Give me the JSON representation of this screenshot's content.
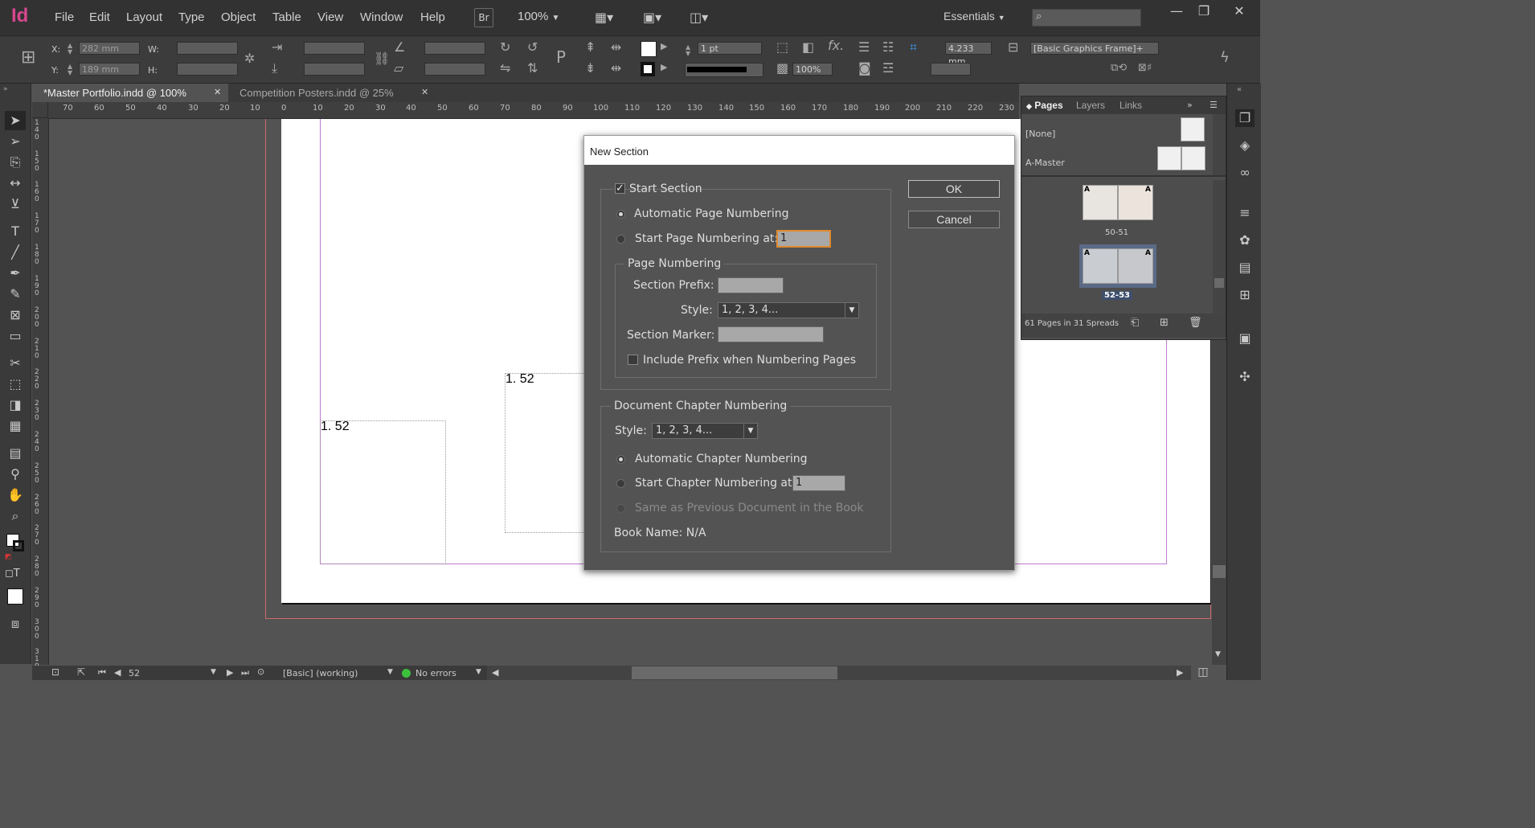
{
  "app": {
    "logo": "Id"
  },
  "menu": [
    "File",
    "Edit",
    "Layout",
    "Type",
    "Object",
    "Table",
    "View",
    "Window",
    "Help"
  ],
  "menubar": {
    "bridge": "Br",
    "zoom": "100%",
    "workspace": "Essentials"
  },
  "window_controls": {
    "minimize": "—",
    "maximize": "❐",
    "close": "✕"
  },
  "control": {
    "x_label": "X:",
    "x_value": "282 mm",
    "y_label": "Y:",
    "y_value": "189 mm",
    "w_label": "W:",
    "h_label": "H:",
    "stroke_weight": "1 pt",
    "opacity": "100%",
    "fitting_value": "4.233 mm",
    "object_style": "[Basic Graphics Frame]+"
  },
  "tabs": [
    {
      "label": "*Master Portfolio.indd @ 100%",
      "close": "✕"
    },
    {
      "label": "Competition Posters.indd @ 25%",
      "close": "✕"
    }
  ],
  "ruler_h": [
    "70",
    "60",
    "50",
    "40",
    "30",
    "20",
    "10",
    "0",
    "10",
    "20",
    "30",
    "40",
    "50",
    "60",
    "70",
    "80",
    "90",
    "100",
    "110",
    "120",
    "130",
    "140",
    "150",
    "160",
    "170",
    "180",
    "190",
    "200",
    "210",
    "220",
    "230"
  ],
  "ruler_v": [
    "140",
    "150",
    "160",
    "170",
    "180",
    "190",
    "200",
    "210",
    "220",
    "230",
    "240",
    "250",
    "260",
    "270",
    "280",
    "290",
    "300",
    "310"
  ],
  "page_content": {
    "frame1_text": "1.  52",
    "frame2_text": "1.  52"
  },
  "pages_panel": {
    "tabs": [
      "Pages",
      "Layers",
      "Links"
    ],
    "none_master": "[None]",
    "a_master": "A-Master",
    "spread1_label": "50-51",
    "spread2_label": "52-53",
    "master_letter": "A",
    "summary": "61 Pages in 31 Spreads"
  },
  "dialog": {
    "title": "New Section",
    "start_section": "Start Section",
    "auto_page_numbering": "Automatic Page Numbering",
    "start_page_numbering": "Start Page Numbering at:",
    "start_page_value": "1",
    "page_numbering_group": "Page Numbering",
    "section_prefix": "Section Prefix:",
    "style_label": "Style:",
    "style_value": "1, 2, 3, 4...",
    "section_marker": "Section Marker:",
    "include_prefix": "Include Prefix when Numbering Pages",
    "chapter_group": "Document Chapter Numbering",
    "chapter_style_label": "Style:",
    "chapter_style_value": "1, 2, 3, 4...",
    "auto_chapter": "Automatic Chapter Numbering",
    "start_chapter": "Start Chapter Numbering at:",
    "start_chapter_value": "1",
    "same_as_previous": "Same as Previous Document in the Book",
    "book_name": "Book Name: N/A",
    "ok": "OK",
    "cancel": "Cancel"
  },
  "status": {
    "page": "52",
    "preflight_profile": "[Basic] (working)",
    "errors": "No errors"
  },
  "colors": {
    "accent_logo": "#d6478f",
    "bleed_guide": "#d06a6a",
    "margin_guide": "#c07ad0",
    "no_errors": "#3cc13c"
  }
}
